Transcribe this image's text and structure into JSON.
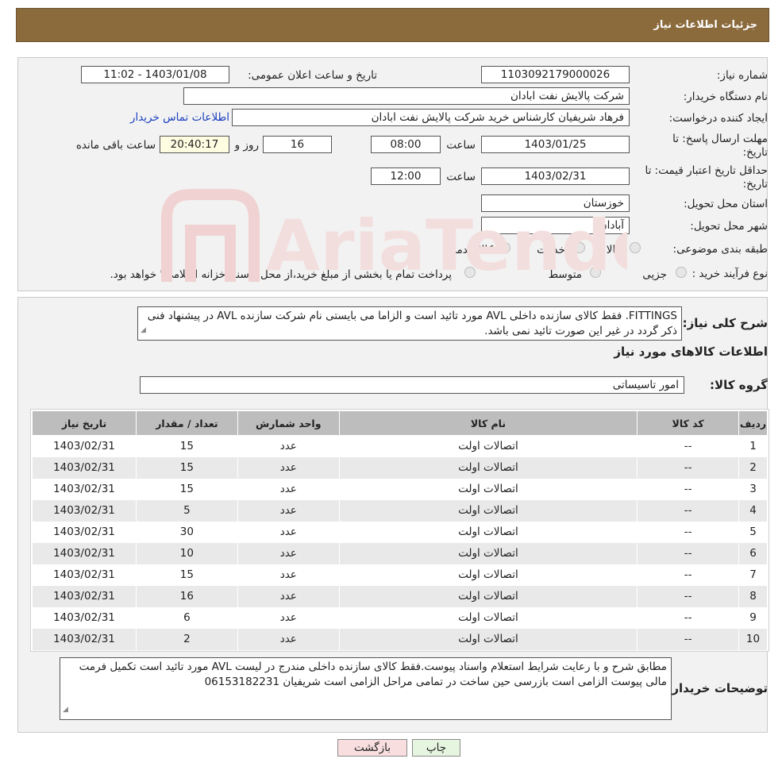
{
  "header": {
    "title": "جزئیات اطلاعات نیاز"
  },
  "fields": {
    "need_number_label": "شماره نیاز:",
    "need_number": "1103092179000026",
    "announce_label": "تاریخ و ساعت اعلان عمومی:",
    "announce_value": "1403/01/08 - 11:02",
    "buyer_org_label": "نام دستگاه خریدار:",
    "buyer_org": "شرکت پالایش نفت ابادان",
    "creator_label": "ایجاد کننده درخواست:",
    "creator": "فرهاد شریفیان کارشناس خرید شرکت پالایش نفت ابادان",
    "contact_link": "اطلاعات تماس خریدار",
    "deadline_label_1": "مهلت ارسال پاسخ: تا",
    "deadline_label_2": "تاریخ:",
    "deadline_date": "1403/01/25",
    "time_label": "ساعت",
    "deadline_time": "08:00",
    "days": "16",
    "days_label": "روز و",
    "remaining": "20:40:17",
    "remaining_label": "ساعت باقی مانده",
    "validity_label_1": "حداقل تاریخ اعتبار قیمت: تا",
    "validity_label_2": "تاریخ:",
    "validity_date": "1403/02/31",
    "validity_time": "12:00",
    "province_label": "استان محل تحویل:",
    "province": "خوزستان",
    "city_label": "شهر محل تحویل:",
    "city": "آبادان",
    "category_label": "طبقه بندی موضوعی:",
    "category_options": [
      "کالا",
      "خدمت",
      "کالا/خدمت"
    ],
    "process_label": "نوع فرآیند خرید :",
    "process_options": [
      "جزیی",
      "متوسط"
    ],
    "process_note": "پرداخت تمام یا بخشی از مبلغ خرید،از محل \"اسناد خزانه اسلامی\" خواهد بود."
  },
  "watermark": {
    "text": "AriaTender.neT"
  },
  "description": {
    "label": "شرح کلی نیاز:",
    "text": "FITTINGS. فقط کالای سازنده داخلی AVL مورد تائید است و الزاما می بایستی نام شرکت سازنده AVL در پیشنهاد فنی ذکر گردد در غیر این صورت تائید نمی باشد."
  },
  "goods": {
    "section_title": "اطلاعات کالاهای مورد نیاز",
    "group_label": "گروه کالا:",
    "group_value": "امور تاسیساتی",
    "columns": [
      "ردیف",
      "کد کالا",
      "نام کالا",
      "واحد شمارش",
      "تعداد / مقدار",
      "تاریخ نیاز"
    ],
    "rows": [
      [
        "1",
        "--",
        "اتصالات اولت",
        "عدد",
        "15",
        "1403/02/31"
      ],
      [
        "2",
        "--",
        "اتصالات اولت",
        "عدد",
        "15",
        "1403/02/31"
      ],
      [
        "3",
        "--",
        "اتصالات اولت",
        "عدد",
        "15",
        "1403/02/31"
      ],
      [
        "4",
        "--",
        "اتصالات اولت",
        "عدد",
        "5",
        "1403/02/31"
      ],
      [
        "5",
        "--",
        "اتصالات اولت",
        "عدد",
        "30",
        "1403/02/31"
      ],
      [
        "6",
        "--",
        "اتصالات اولت",
        "عدد",
        "10",
        "1403/02/31"
      ],
      [
        "7",
        "--",
        "اتصالات اولت",
        "عدد",
        "15",
        "1403/02/31"
      ],
      [
        "8",
        "--",
        "اتصالات اولت",
        "عدد",
        "16",
        "1403/02/31"
      ],
      [
        "9",
        "--",
        "اتصالات اولت",
        "عدد",
        "6",
        "1403/02/31"
      ],
      [
        "10",
        "--",
        "اتصالات اولت",
        "عدد",
        "2",
        "1403/02/31"
      ]
    ]
  },
  "buyer_notes": {
    "label": "توضیحات خریدار:",
    "text": "مطابق شرح و با رعایت شرایط استعلام واسناد پیوست.فقط کالای سازنده داخلی مندرج در لیست AVL مورد تائید است تکمیل فرمت مالی پیوست الزامی است بازرسی حین ساخت در تمامی مراحل الزامی  است شریفیان 06153182231"
  },
  "buttons": {
    "print": "چاپ",
    "back": "بازگشت"
  }
}
